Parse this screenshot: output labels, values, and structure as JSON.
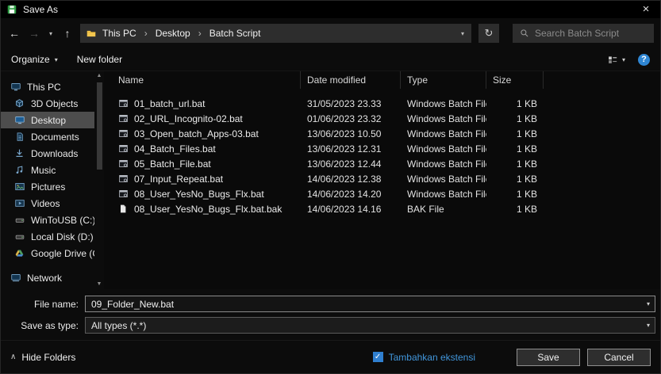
{
  "window": {
    "title": "Save As"
  },
  "nav": {
    "breadcrumb": [
      "This PC",
      "Desktop",
      "Batch Script"
    ],
    "search_placeholder": "Search Batch Script"
  },
  "toolbar": {
    "organize": "Organize",
    "new_folder": "New folder",
    "help_glyph": "?"
  },
  "sidebar": {
    "items": [
      {
        "label": "This PC",
        "icon": "pc",
        "indent": false,
        "selected": false
      },
      {
        "label": "3D Objects",
        "icon": "cube",
        "indent": true,
        "selected": false
      },
      {
        "label": "Desktop",
        "icon": "desktop",
        "indent": true,
        "selected": true
      },
      {
        "label": "Documents",
        "icon": "documents",
        "indent": true,
        "selected": false
      },
      {
        "label": "Downloads",
        "icon": "downloads",
        "indent": true,
        "selected": false
      },
      {
        "label": "Music",
        "icon": "music",
        "indent": true,
        "selected": false
      },
      {
        "label": "Pictures",
        "icon": "pictures",
        "indent": true,
        "selected": false
      },
      {
        "label": "Videos",
        "icon": "videos",
        "indent": true,
        "selected": false
      },
      {
        "label": "WinToUSB (C:)",
        "icon": "drive",
        "indent": true,
        "selected": false
      },
      {
        "label": "Local Disk (D:)",
        "icon": "drive",
        "indent": true,
        "selected": false
      },
      {
        "label": "Google Drive (G:",
        "icon": "gdrive",
        "indent": true,
        "selected": false
      },
      {
        "label": "Network",
        "icon": "network",
        "indent": false,
        "selected": false
      }
    ]
  },
  "filelist": {
    "columns": [
      "Name",
      "Date modified",
      "Type",
      "Size"
    ],
    "rows": [
      {
        "name": "01_batch_url.bat",
        "date": "31/05/2023 23.33",
        "type": "Windows Batch File",
        "size": "1 KB",
        "icon": "bat"
      },
      {
        "name": "02_URL_Incognito-02.bat",
        "date": "01/06/2023 23.32",
        "type": "Windows Batch File",
        "size": "1 KB",
        "icon": "bat"
      },
      {
        "name": "03_Open_batch_Apps-03.bat",
        "date": "13/06/2023 10.50",
        "type": "Windows Batch File",
        "size": "1 KB",
        "icon": "bat"
      },
      {
        "name": "04_Batch_Files.bat",
        "date": "13/06/2023 12.31",
        "type": "Windows Batch File",
        "size": "1 KB",
        "icon": "bat"
      },
      {
        "name": "05_Batch_File.bat",
        "date": "13/06/2023 12.44",
        "type": "Windows Batch File",
        "size": "1 KB",
        "icon": "bat"
      },
      {
        "name": "07_Input_Repeat.bat",
        "date": "14/06/2023 12.38",
        "type": "Windows Batch File",
        "size": "1 KB",
        "icon": "bat"
      },
      {
        "name": "08_User_YesNo_Bugs_Flx.bat",
        "date": "14/06/2023 14.20",
        "type": "Windows Batch File",
        "size": "1 KB",
        "icon": "bat"
      },
      {
        "name": "08_User_YesNo_Bugs_Flx.bat.bak",
        "date": "14/06/2023 14.16",
        "type": "BAK File",
        "size": "1 KB",
        "icon": "bak"
      }
    ]
  },
  "fields": {
    "file_name_label": "File name:",
    "file_name_value": "09_Folder_New.bat",
    "save_type_label": "Save as type:",
    "save_type_value": "All types (*.*)"
  },
  "footer": {
    "hide_folders": "Hide Folders",
    "checkbox_label": "Tambahkan ekstensi",
    "checkbox_checked": true,
    "save": "Save",
    "cancel": "Cancel"
  },
  "icons": {
    "back": "←",
    "forward": "→",
    "up": "↑",
    "dropdown": "▾",
    "refresh": "↻",
    "close": "×",
    "check": "✓",
    "hide_chevron": "∧",
    "crumb_sep": "›",
    "scroll_up": "▲",
    "scroll_down": "▼"
  },
  "colors": {
    "accent_checkbox_blue": "#2f7fd0",
    "link_label_blue": "#4196db",
    "help_circle_blue": "#2f86d3",
    "selected_sidebar_gray": "#4d4d4d",
    "addressbar_gray": "#2d2d2d",
    "background_black": "#0c0c0c"
  }
}
